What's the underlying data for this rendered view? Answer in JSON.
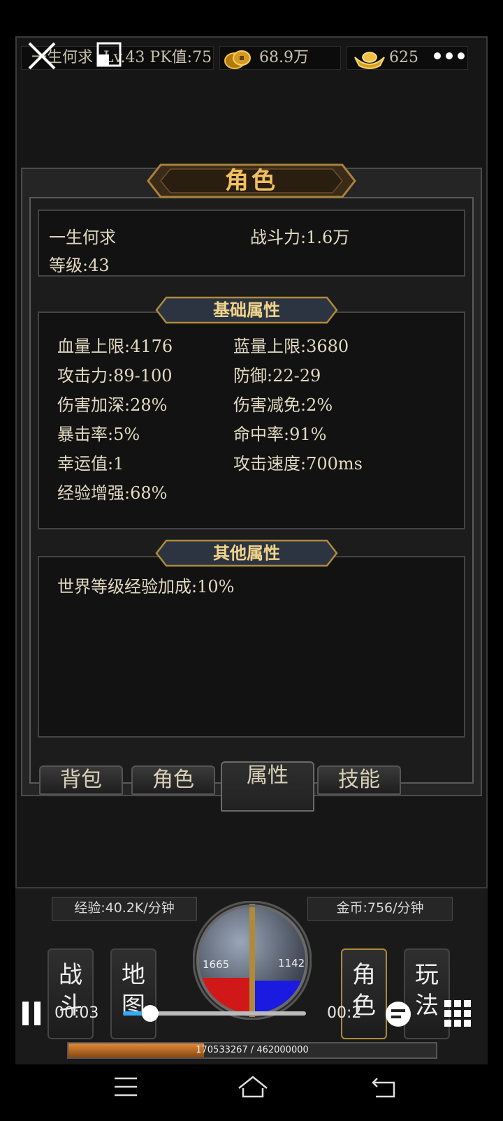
{
  "topbar": {
    "name": "一生何求",
    "level_pk": "Lv.43 PK值:75",
    "copper": "68.9万",
    "ingot": "625",
    "icons": [
      "close-icon",
      "resize-icon",
      "more-dots-icon",
      "copper-coin-icon",
      "gold-ingot-icon"
    ]
  },
  "panel": {
    "title": "角色",
    "character": {
      "name": "一生何求",
      "power": "战斗力:1.6万",
      "level": "等级:43"
    },
    "basic_title": "基础属性",
    "basic": [
      "血量上限:4176",
      "蓝量上限:3680",
      "攻击力:89-100",
      "防御:22-29",
      "伤害加深:28%",
      "伤害减免:2%",
      "暴击率:5%",
      "命中率:91%",
      "幸运值:1",
      "攻击速度:700ms",
      "经验增强:68%"
    ],
    "other_title": "其他属性",
    "other": [
      "世界等级经验加成:10%"
    ]
  },
  "tabs": [
    "背包",
    "角色",
    "属性",
    "技能"
  ],
  "active_tab": "属性",
  "hud": {
    "exp_rate": "经验:40.2K/分钟",
    "gold_rate": "金币:756/分钟",
    "hp": "1665",
    "mp": "1142",
    "buttons": [
      "战斗",
      "地图",
      "角色",
      "玩法"
    ],
    "exp_bar": "170533267 / 462000000",
    "exp_fraction": 0.369
  },
  "video": {
    "current": "00:03",
    "remaining": "00:2",
    "progress": 0.15
  },
  "colors": {
    "gold": "#f0c060",
    "hp": "#d01818",
    "mp": "#1a1ae0",
    "exp": "#c86a1a"
  }
}
